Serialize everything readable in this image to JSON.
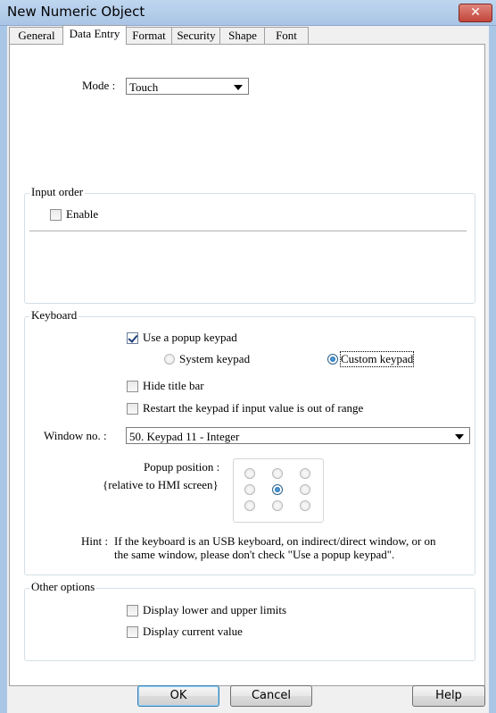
{
  "window": {
    "title": "New Numeric Object",
    "close_glyph": "✕"
  },
  "tabs": [
    {
      "label": "General"
    },
    {
      "label": "Data Entry"
    },
    {
      "label": "Format"
    },
    {
      "label": "Security"
    },
    {
      "label": "Shape"
    },
    {
      "label": "Font"
    }
  ],
  "active_tab": "Data Entry",
  "mode": {
    "label": "Mode :",
    "value": "Touch"
  },
  "input_order": {
    "title": "Input order",
    "enable_label": "Enable",
    "enable_checked": false
  },
  "keyboard": {
    "title": "Keyboard",
    "use_popup_label": "Use a popup keypad",
    "use_popup_checked": true,
    "system_keypad_label": "System keypad",
    "custom_keypad_label": "Custom keypad",
    "keypad_selection": "Custom keypad",
    "hide_title_label": "Hide title bar",
    "hide_title_checked": false,
    "restart_label": "Restart the keypad if input value is out of range",
    "restart_checked": false,
    "window_no_label": "Window no. :",
    "window_no_value": "50. Keypad 11 - Integer",
    "popup_position_label": "Popup position :",
    "popup_position_sub": "{relative to HMI screen}",
    "popup_position_selected": "center",
    "hint_label": "Hint :",
    "hint_line1": "If the keyboard is an USB keyboard, on indirect/direct window, or on",
    "hint_line2": "the same window, please don't check \"Use a popup keypad\"."
  },
  "other_options": {
    "title": "Other options",
    "limits_label": "Display lower and upper limits",
    "limits_checked": false,
    "current_label": "Display current value",
    "current_checked": false
  },
  "buttons": {
    "ok": "OK",
    "cancel": "Cancel",
    "help": "Help"
  }
}
